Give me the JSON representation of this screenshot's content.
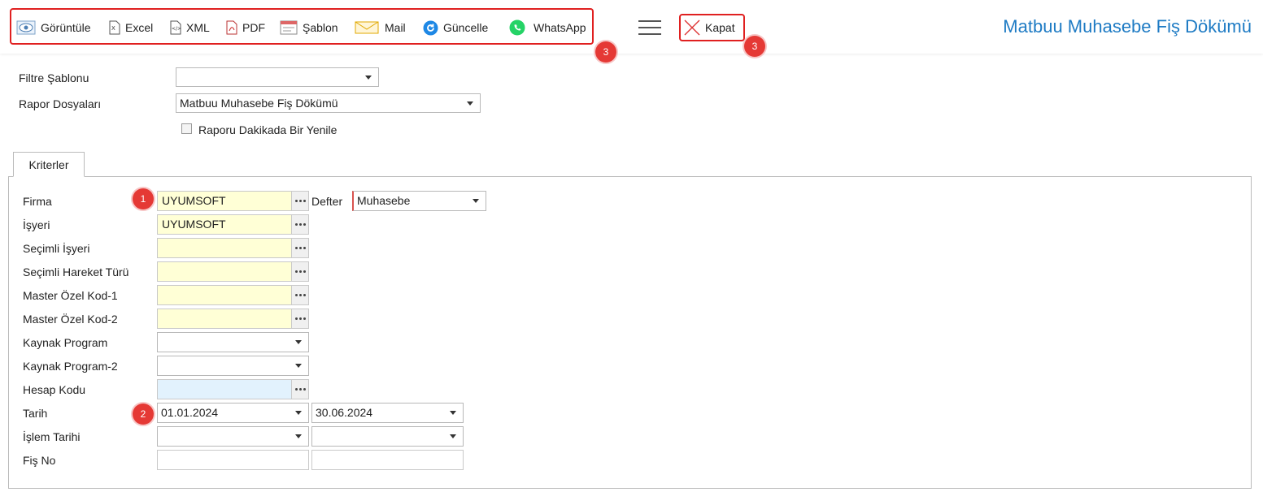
{
  "toolbar": {
    "items": [
      {
        "label": "Görüntüle",
        "icon": "eye-icon"
      },
      {
        "label": "Excel",
        "icon": "excel-file-icon"
      },
      {
        "label": "XML",
        "icon": "xml-file-icon"
      },
      {
        "label": "PDF",
        "icon": "pdf-file-icon"
      },
      {
        "label": "Şablon",
        "icon": "template-icon"
      },
      {
        "label": "Mail",
        "icon": "mail-envelope-icon"
      },
      {
        "label": "Güncelle",
        "icon": "refresh-icon"
      },
      {
        "label": "WhatsApp",
        "icon": "whatsapp-icon"
      }
    ],
    "close_label": "Kapat"
  },
  "badges": {
    "one": "1",
    "two": "2",
    "three": "3"
  },
  "page_title": "Matbuu Muhasebe Fiş Dökümü",
  "top_form": {
    "filter_template_label": "Filtre Şablonu",
    "filter_template_value": "",
    "report_files_label": "Rapor Dosyaları",
    "report_files_value": "Matbuu Muhasebe Fiş Dökümü",
    "refresh_checkbox_label": "Raporu Dakikada Bir Yenile",
    "refresh_checked": false
  },
  "tab": {
    "label": "Kriterler"
  },
  "criteria": {
    "firma_label": "Firma",
    "firma_value": "UYUMSOFT",
    "defter_label": "Defter",
    "defter_value": "Muhasebe",
    "isyeri_label": "İşyeri",
    "isyeri_value": "UYUMSOFT",
    "secimli_isyeri_label": "Seçimli İşyeri",
    "secimli_hareket_label": "Seçimli Hareket Türü",
    "master_ozel1_label": "Master Özel Kod-1",
    "master_ozel2_label": "Master Özel Kod-2",
    "kaynak_program_label": "Kaynak Program",
    "kaynak_program2_label": "Kaynak Program-2",
    "hesap_kodu_label": "Hesap Kodu",
    "tarih_label": "Tarih",
    "tarih_start": "01.01.2024",
    "tarih_end": "30.06.2024",
    "islem_tarihi_label": "İşlem Tarihi",
    "fis_no_label": "Fiş No"
  },
  "colors": {
    "accent": "#1e7bc4",
    "highlight_red": "#e02020",
    "field_yellow": "#ffffd6",
    "field_blue": "#e2f2fd"
  }
}
